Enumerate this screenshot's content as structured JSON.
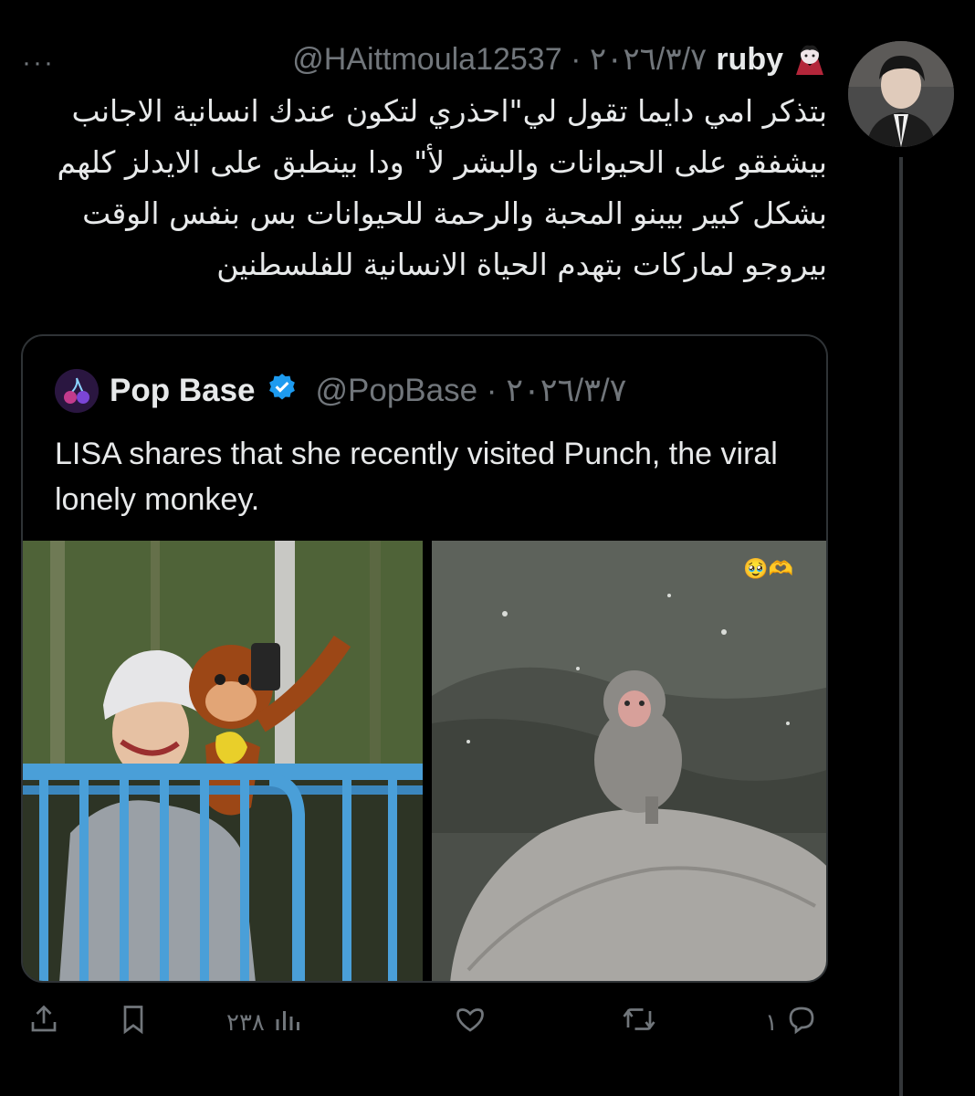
{
  "tweet": {
    "display_name": "ruby",
    "handle_date": "@HAittmoula12537 · ٢٠٢٦/٣/٧",
    "text": "بتذكر امي دايما تقول لي\"احذري لتكون عندك انسانية الاجانب بيشفقو على الحيوانات والبشر لأ\" ودا بينطبق على الايدلز كلهم بشكل كبير بيبنو المحبة والرحمة للحيوانات بس بنفس الوقت بيروجو لماركات بتهدم الحياة الانسانية للفلسطنين",
    "more_label": "···"
  },
  "quote": {
    "name": "Pop Base",
    "handle_date": "@PopBase · ٢٠٢٦/٣/٧",
    "text": "LISA shares that she recently visited Punch, the viral lonely monkey.",
    "verified": true,
    "emoji_overlay": "🥹🫶"
  },
  "actions": {
    "replies": "١",
    "retweets": "",
    "likes": "",
    "views": "٢٣٨"
  },
  "colors": {
    "background": "#000000",
    "text": "#e7e9ea",
    "muted": "#71767b",
    "border": "#2f3336",
    "verified": "#1d9bf0"
  },
  "icons": [
    "vampire-emoji-icon",
    "verified-badge-icon",
    "cherry-logo-icon",
    "reply-icon",
    "retweet-icon",
    "like-icon",
    "views-icon",
    "bookmark-icon",
    "share-icon",
    "more-icon"
  ]
}
